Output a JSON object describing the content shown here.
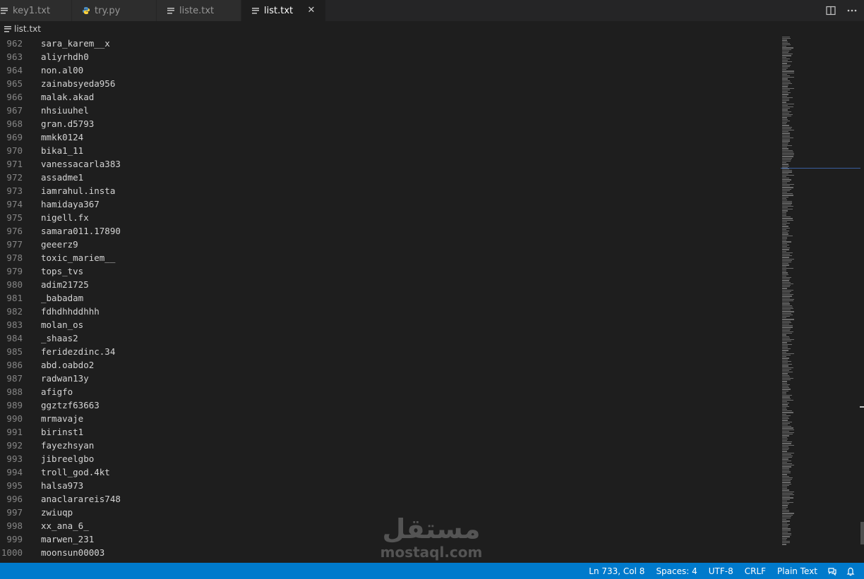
{
  "tabs": [
    {
      "label": "key1.txt",
      "icon": "text-file-icon",
      "active": false
    },
    {
      "label": "try.py",
      "icon": "python-file-icon",
      "active": false
    },
    {
      "label": "liste.txt",
      "icon": "text-file-icon",
      "active": false
    },
    {
      "label": "list.txt",
      "icon": "text-file-icon",
      "active": true
    }
  ],
  "tab_close_glyph": "✕",
  "breadcrumb": {
    "file": "list.txt"
  },
  "editor": {
    "lines": [
      {
        "n": "962",
        "text": "sara_karem__x"
      },
      {
        "n": "963",
        "text": "aliyrhdh0"
      },
      {
        "n": "964",
        "text": "non.al00"
      },
      {
        "n": "965",
        "text": "zainabsyeda956"
      },
      {
        "n": "966",
        "text": "malak.akad"
      },
      {
        "n": "967",
        "text": "nhsiuuhel"
      },
      {
        "n": "968",
        "text": "gran.d5793"
      },
      {
        "n": "969",
        "text": "mmkk0124"
      },
      {
        "n": "970",
        "text": "bika1_11"
      },
      {
        "n": "971",
        "text": "vanessacarla383"
      },
      {
        "n": "972",
        "text": "assadme1"
      },
      {
        "n": "973",
        "text": "iamrahul.insta"
      },
      {
        "n": "974",
        "text": "hamidaya367"
      },
      {
        "n": "975",
        "text": "nigell.fx"
      },
      {
        "n": "976",
        "text": "samara011.17890"
      },
      {
        "n": "977",
        "text": "geeerz9"
      },
      {
        "n": "978",
        "text": "toxic_mariem__"
      },
      {
        "n": "979",
        "text": "tops_tvs"
      },
      {
        "n": "980",
        "text": "adim21725"
      },
      {
        "n": "981",
        "text": "_babadam"
      },
      {
        "n": "982",
        "text": "fdhdhhddhhh"
      },
      {
        "n": "983",
        "text": "molan_os"
      },
      {
        "n": "984",
        "text": "_shaas2"
      },
      {
        "n": "985",
        "text": "feridezdinc.34"
      },
      {
        "n": "986",
        "text": "abd.oabdo2"
      },
      {
        "n": "987",
        "text": "radwan13y"
      },
      {
        "n": "988",
        "text": "afigfo"
      },
      {
        "n": "989",
        "text": "ggztzf63663"
      },
      {
        "n": "990",
        "text": "mrmavaje"
      },
      {
        "n": "991",
        "text": "birinst1"
      },
      {
        "n": "992",
        "text": "fayezhsyan"
      },
      {
        "n": "993",
        "text": "jibreelgbo"
      },
      {
        "n": "994",
        "text": "troll_god.4kt"
      },
      {
        "n": "995",
        "text": "halsa973"
      },
      {
        "n": "996",
        "text": "anaclarareis748"
      },
      {
        "n": "997",
        "text": "zwiuqp"
      },
      {
        "n": "998",
        "text": "xx_ana_6_"
      },
      {
        "n": "999",
        "text": "marwen_231"
      },
      {
        "n": "1000",
        "text": "moonsun00003"
      }
    ]
  },
  "watermark": {
    "arabic": "مستقل",
    "latin": "mostaql.com"
  },
  "statusbar": {
    "position": "Ln 733, Col 8",
    "spaces": "Spaces: 4",
    "encoding": "UTF-8",
    "eol": "CRLF",
    "language": "Plain Text",
    "feedback_icon": "feedback-icon",
    "bell_icon": "bell-icon"
  },
  "colors": {
    "statusbar": "#007acc",
    "editor_bg": "#1e1e1e",
    "tabbar_bg": "#252526",
    "active_tab_text": "#ffffff"
  }
}
